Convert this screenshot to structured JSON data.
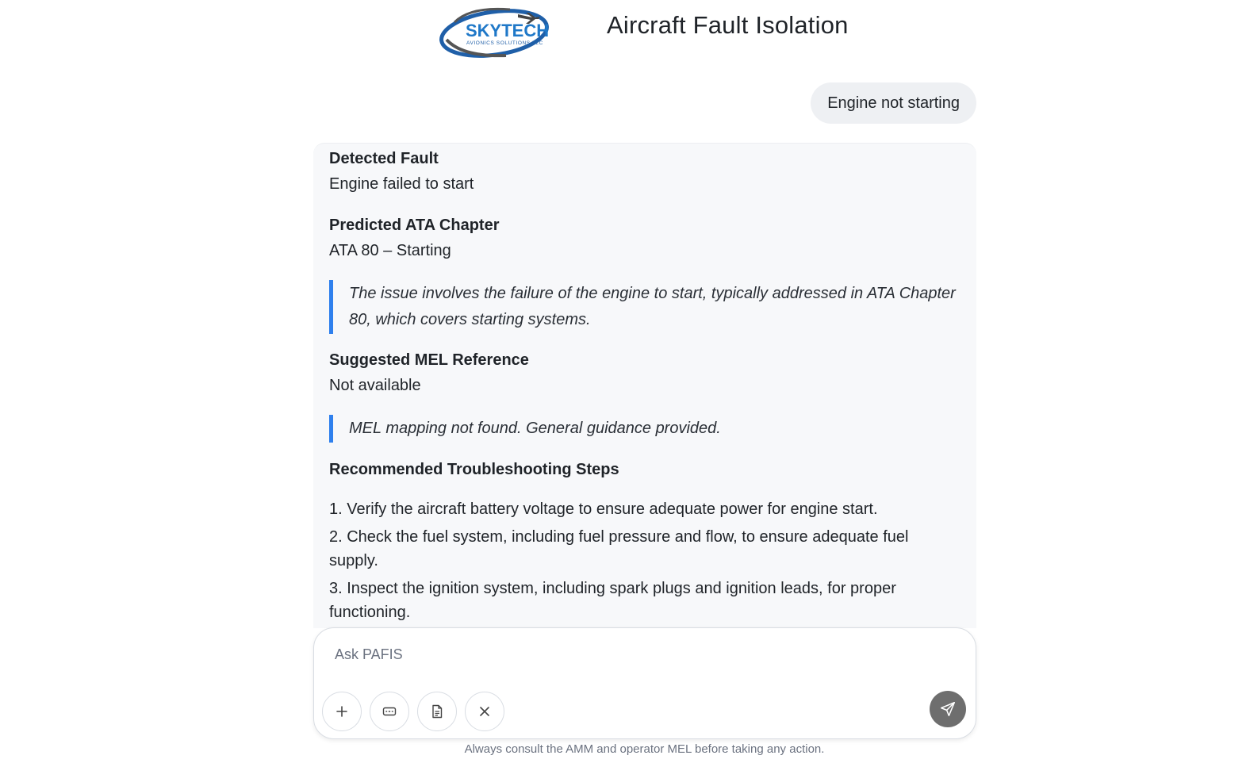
{
  "header": {
    "logo_text": "SKYTECH",
    "logo_subtext": "AVIONICS SOLUTIONS LLC",
    "title": "Aircraft Fault Isolation"
  },
  "conversation": {
    "user_message": "Engine not starting",
    "response": {
      "detected_fault": {
        "heading": "Detected Fault",
        "value": "Engine failed to start"
      },
      "ata_chapter": {
        "heading": "Predicted ATA Chapter",
        "value": "ATA 80 – Starting",
        "note": "The issue involves the failure of the engine to start, typically addressed in ATA Chapter 80, which covers starting systems."
      },
      "mel_reference": {
        "heading": "Suggested MEL Reference",
        "value": "Not available",
        "note": "MEL mapping not found. General guidance provided."
      },
      "troubleshooting": {
        "heading": "Recommended Troubleshooting Steps",
        "steps": [
          "1. Verify the aircraft battery voltage to ensure adequate power for engine start.",
          "2. Check the fuel system, including fuel pressure and flow, to ensure adequate fuel supply.",
          "3. Inspect the ignition system, including spark plugs and ignition leads, for proper functioning."
        ]
      }
    }
  },
  "composer": {
    "placeholder": "Ask PAFIS",
    "tools": [
      "plus-icon",
      "keyboard-icon",
      "document-icon",
      "close-icon"
    ],
    "send_icon": "send-icon"
  },
  "footer": {
    "disclaimer": "Always consult the AMM and operator MEL before taking any action."
  },
  "colors": {
    "accent_blue": "#2f80ed",
    "logo_blue": "#1f78c8",
    "send_button": "#6e6e6e"
  }
}
